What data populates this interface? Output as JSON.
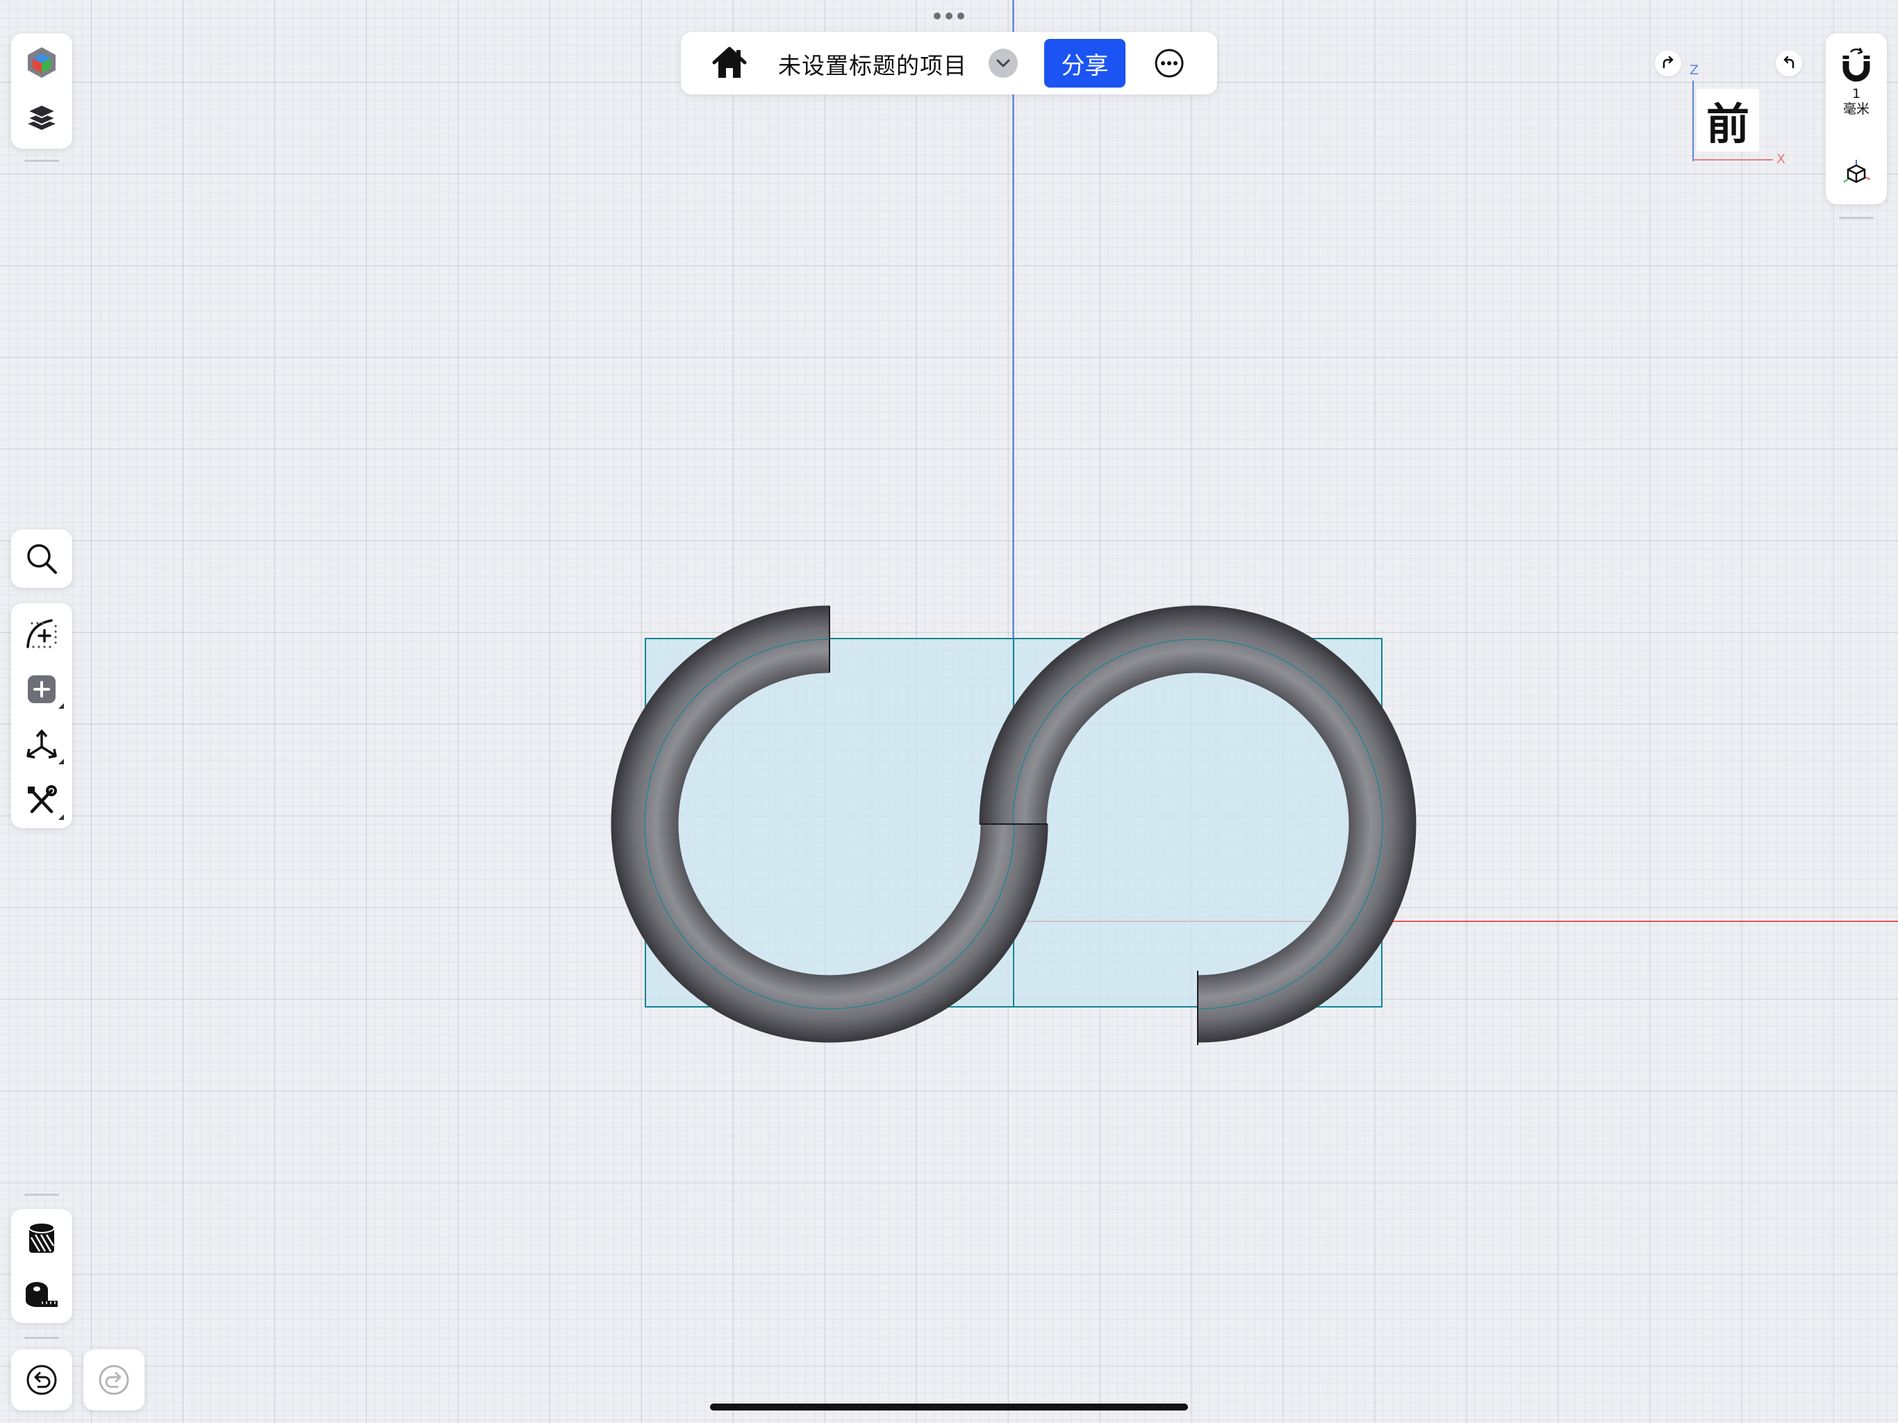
{
  "document": {
    "title": "未设置标题的项目",
    "share_label": "分享"
  },
  "view": {
    "orientation_label": "前",
    "axis_x": "X",
    "axis_z": "Z"
  },
  "snap": {
    "value": "1",
    "unit": "毫米"
  },
  "icons": {
    "left_top": [
      "view-mode-cube-icon",
      "layers-icon"
    ],
    "left_middle": [
      "search-icon",
      "sketch-curve-icon",
      "add-primitive-icon",
      "transform-icon",
      "modify-tools-icon"
    ],
    "left_bottom": [
      "visual-style-icon",
      "measure-tape-icon"
    ],
    "history": [
      "undo-icon",
      "redo-icon"
    ],
    "top_bar": [
      "home-icon",
      "chevron-down-icon",
      "more-icon"
    ],
    "right": [
      "snap-magnet-icon",
      "view-cube-icon",
      "rotate-right-icon",
      "rotate-left-icon"
    ]
  },
  "colors": {
    "accent": "#1b54f3",
    "canvas": "#eeeff3",
    "x_axis": "#e25555",
    "z_axis": "#3c6fe0",
    "selection_fill": "#c9e6f0",
    "selection_stroke": "#138595",
    "model": "#6c6c72"
  }
}
